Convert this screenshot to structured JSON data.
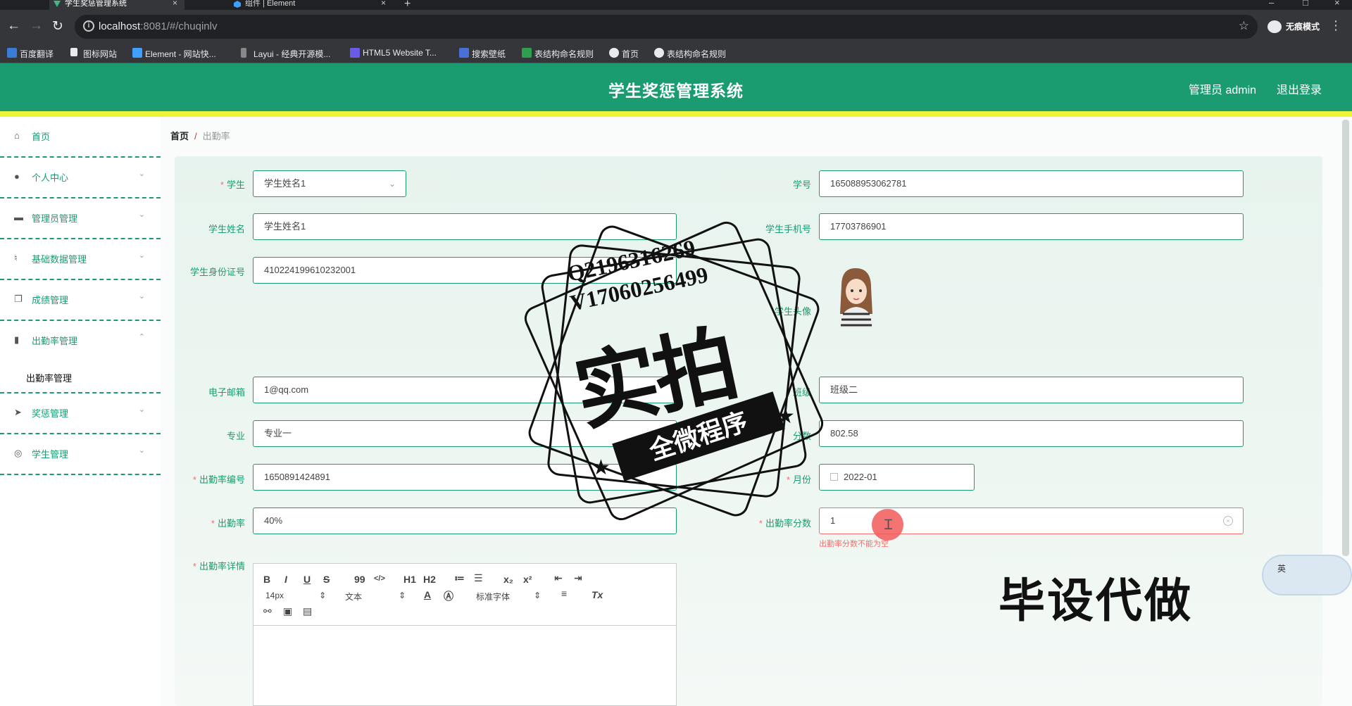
{
  "browser": {
    "tabs": [
      {
        "title": "学生奖惩管理系统",
        "active": true
      },
      {
        "title": "组件 | Element",
        "active": false
      }
    ],
    "url_host": "localhost",
    "url_rest": ":8081/#/chuqinlv",
    "profile": "无痕模式",
    "bookmarks": [
      "百度翻译",
      "图标网站",
      "Element - 网站快...",
      "Layui - 经典开源模...",
      "HTML5 Website T...",
      "搜索壁纸",
      "表结构命名规则",
      "首页",
      "表结构命名规则"
    ]
  },
  "header": {
    "title": "学生奖惩管理系统",
    "admin": "管理员 admin",
    "logout": "退出登录",
    "color": "#1a9c70",
    "accent_bar": "#eff23a"
  },
  "sidebar": {
    "items": [
      {
        "label": "首页",
        "icon": "home-icon"
      },
      {
        "label": "个人中心",
        "icon": "user-icon"
      },
      {
        "label": "管理员管理",
        "icon": "chat-icon"
      },
      {
        "label": "基础数据管理",
        "icon": "mic-icon"
      },
      {
        "label": "成绩管理",
        "icon": "copy-icon"
      },
      {
        "label": "出勤率管理",
        "icon": "bar-chart-icon"
      },
      {
        "label": "奖惩管理",
        "icon": "send-icon"
      },
      {
        "label": "学生管理",
        "icon": "compass-icon"
      }
    ],
    "submenu": "出勤率管理"
  },
  "breadcrumb": {
    "home": "首页",
    "separator": "/",
    "current": "出勤率"
  },
  "form": {
    "student_label": "学生",
    "student_value": "学生姓名1",
    "student_no_label": "学号",
    "student_no_value": "165088953062781",
    "name_label": "学生姓名",
    "name_value": "学生姓名1",
    "phone_label": "学生手机号",
    "phone_value": "17703786901",
    "idcard_label": "学生身份证号",
    "idcard_value": "410224199610232001",
    "avatar_label": "学生头像",
    "email_label": "电子邮箱",
    "email_value": "1@qq.com",
    "class_label": "班级",
    "class_value": "班级二",
    "major_label": "专业",
    "major_value": "专业一",
    "score_label": "分数",
    "score_value": "802.58",
    "attendance_no_label": "出勤率编号",
    "attendance_no_value": "1650891424891",
    "month_label": "月份",
    "month_value": "2022-01",
    "rate_label": "出勤率",
    "rate_value": "40%",
    "rate_score_label": "出勤率分数",
    "rate_score_value": "1",
    "rate_score_error": "出勤率分数不能为空",
    "detail_label": "出勤率详情",
    "required_mark": "*"
  },
  "editor": {
    "bold": "B",
    "italic": "I",
    "underline": "U",
    "strike": "S",
    "quote": "99",
    "code": "</>",
    "h1": "H1",
    "h2": "H2",
    "sub": "x₂",
    "sup": "x²",
    "font_size": "14px",
    "block_format": "文本",
    "font_family": "标准字体",
    "clear": "Tx"
  },
  "watermark": {
    "line1": "Q2196316269",
    "line2": "V17060256499",
    "big": "实拍",
    "banner": "全微程序",
    "ad": "毕设代做"
  },
  "ime": {
    "label": "英"
  }
}
